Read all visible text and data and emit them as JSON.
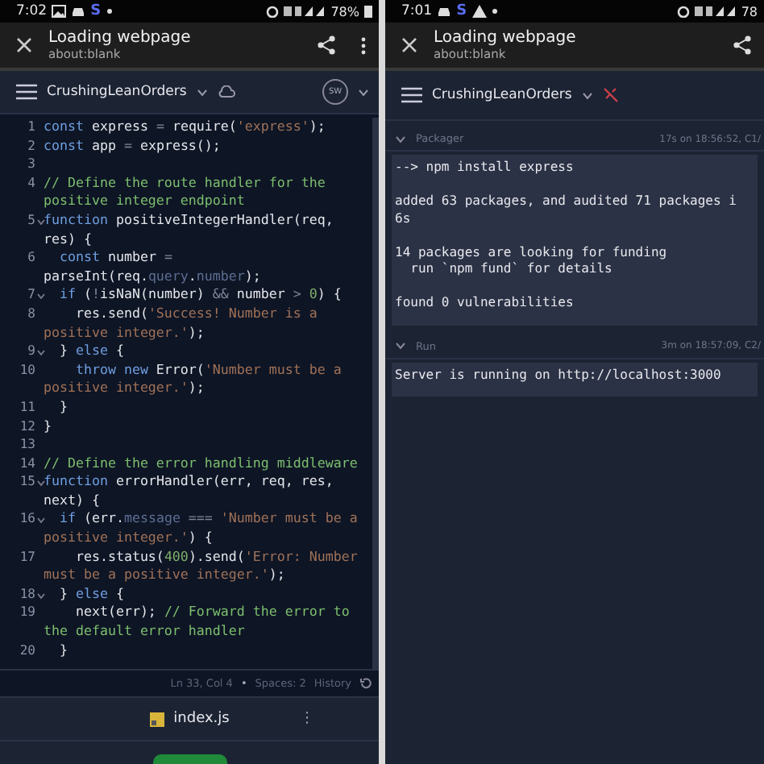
{
  "left": {
    "status_bar": {
      "time": "7:02",
      "app_letter": "S",
      "battery": "78%"
    },
    "header": {
      "title": "Loading webpage",
      "subtitle": "about:blank"
    },
    "toolbar": {
      "project": "CrushingLeanOrders",
      "avatar": "SW"
    },
    "code": [
      {
        "number": "1",
        "foldable": false,
        "rows": [
          {
            "tokens": [
              {
                "kind": "keyword",
                "text": "const"
              },
              {
                "kind": "plain",
                "text": " express "
              },
              {
                "kind": "operator",
                "text": "="
              },
              {
                "kind": "plain",
                "text": " require("
              },
              {
                "kind": "string",
                "text": "'express'"
              },
              {
                "kind": "plain",
                "text": ");"
              }
            ]
          }
        ]
      },
      {
        "number": "2",
        "foldable": false,
        "rows": [
          {
            "tokens": [
              {
                "kind": "keyword",
                "text": "const"
              },
              {
                "kind": "plain",
                "text": " app "
              },
              {
                "kind": "operator",
                "text": "="
              },
              {
                "kind": "plain",
                "text": " express();"
              }
            ]
          }
        ]
      },
      {
        "number": "3",
        "foldable": false
      },
      {
        "number": "4",
        "foldable": false,
        "rows": [
          {
            "tokens": [
              {
                "kind": "comment",
                "text": "// Define the route handler for the"
              }
            ]
          },
          {
            "tokens": [
              {
                "kind": "comment",
                "text": "positive integer endpoint"
              }
            ]
          }
        ]
      },
      {
        "number": "5",
        "foldable": true,
        "rows": [
          {
            "tokens": [
              {
                "kind": "keyword",
                "text": "function"
              },
              {
                "kind": "plain",
                "text": " positiveIntegerHandler(req,"
              }
            ]
          },
          {
            "tokens": [
              {
                "kind": "plain",
                "text": "res) {"
              }
            ]
          }
        ]
      },
      {
        "number": "6",
        "foldable": false,
        "rows": [
          {
            "tokens": [
              {
                "kind": "keyword",
                "text": "  const"
              },
              {
                "kind": "plain",
                "text": " number "
              },
              {
                "kind": "operator",
                "text": "="
              }
            ]
          },
          {
            "tokens": [
              {
                "kind": "plain",
                "text": "parseInt(req."
              },
              {
                "kind": "property",
                "text": "query"
              },
              {
                "kind": "plain",
                "text": "."
              },
              {
                "kind": "property",
                "text": "number"
              },
              {
                "kind": "plain",
                "text": ");"
              }
            ]
          }
        ]
      },
      {
        "number": "7",
        "foldable": true,
        "rows": [
          {
            "tokens": [
              {
                "kind": "keyword",
                "text": "  if"
              },
              {
                "kind": "plain",
                "text": " ("
              },
              {
                "kind": "operator",
                "text": "!"
              },
              {
                "kind": "plain",
                "text": "isNaN(number) "
              },
              {
                "kind": "operator",
                "text": "&&"
              },
              {
                "kind": "plain",
                "text": " number "
              },
              {
                "kind": "operator",
                "text": ">"
              },
              {
                "kind": "number",
                "text": " 0"
              },
              {
                "kind": "plain",
                "text": ") {"
              }
            ]
          }
        ]
      },
      {
        "number": "8",
        "foldable": false,
        "rows": [
          {
            "tokens": [
              {
                "kind": "plain",
                "text": "    res.send("
              },
              {
                "kind": "string",
                "text": "'Success! Number is a"
              }
            ]
          },
          {
            "tokens": [
              {
                "kind": "string",
                "text": "positive integer.'"
              },
              {
                "kind": "plain",
                "text": ");"
              }
            ]
          }
        ]
      },
      {
        "number": "9",
        "foldable": true,
        "rows": [
          {
            "tokens": [
              {
                "kind": "plain",
                "text": "  } "
              },
              {
                "kind": "keyword",
                "text": "else"
              },
              {
                "kind": "plain",
                "text": " {"
              }
            ]
          }
        ]
      },
      {
        "number": "10",
        "foldable": false,
        "rows": [
          {
            "tokens": [
              {
                "kind": "keyword",
                "text": "    throw new"
              },
              {
                "kind": "plain",
                "text": " Error("
              },
              {
                "kind": "string",
                "text": "'Number must be a"
              }
            ]
          },
          {
            "tokens": [
              {
                "kind": "string",
                "text": "positive integer.'"
              },
              {
                "kind": "plain",
                "text": ");"
              }
            ]
          }
        ]
      },
      {
        "number": "11",
        "foldable": false,
        "rows": [
          {
            "tokens": [
              {
                "kind": "plain",
                "text": "  }"
              }
            ]
          }
        ]
      },
      {
        "number": "12",
        "foldable": false,
        "rows": [
          {
            "tokens": [
              {
                "kind": "plain",
                "text": "}"
              }
            ]
          }
        ]
      },
      {
        "number": "13",
        "foldable": false
      },
      {
        "number": "14",
        "foldable": false,
        "rows": [
          {
            "tokens": [
              {
                "kind": "comment",
                "text": "// Define the error handling middleware"
              }
            ]
          }
        ]
      },
      {
        "number": "15",
        "foldable": true,
        "rows": [
          {
            "tokens": [
              {
                "kind": "keyword",
                "text": "function"
              },
              {
                "kind": "plain",
                "text": " errorHandler(err, req, res,"
              }
            ]
          },
          {
            "tokens": [
              {
                "kind": "plain",
                "text": "next) {"
              }
            ]
          }
        ]
      },
      {
        "number": "16",
        "foldable": true,
        "rows": [
          {
            "tokens": [
              {
                "kind": "keyword",
                "text": "  if"
              },
              {
                "kind": "plain",
                "text": " (err."
              },
              {
                "kind": "property",
                "text": "message"
              },
              {
                "kind": "operator",
                "text": " === "
              },
              {
                "kind": "string",
                "text": "'Number must be a"
              }
            ]
          },
          {
            "tokens": [
              {
                "kind": "string",
                "text": "positive integer.'"
              },
              {
                "kind": "plain",
                "text": ") {"
              }
            ]
          }
        ]
      },
      {
        "number": "17",
        "foldable": false,
        "rows": [
          {
            "tokens": [
              {
                "kind": "plain",
                "text": "    res.status("
              },
              {
                "kind": "number",
                "text": "400"
              },
              {
                "kind": "plain",
                "text": ").send("
              },
              {
                "kind": "string",
                "text": "'Error: Number"
              }
            ]
          },
          {
            "tokens": [
              {
                "kind": "string",
                "text": "must be a positive integer.'"
              },
              {
                "kind": "plain",
                "text": ");"
              }
            ]
          }
        ]
      },
      {
        "number": "18",
        "foldable": true,
        "rows": [
          {
            "tokens": [
              {
                "kind": "plain",
                "text": "  } "
              },
              {
                "kind": "keyword",
                "text": "else"
              },
              {
                "kind": "plain",
                "text": " {"
              }
            ]
          }
        ]
      },
      {
        "number": "19",
        "foldable": false,
        "rows": [
          {
            "tokens": [
              {
                "kind": "plain",
                "text": "    next(err); "
              },
              {
                "kind": "comment",
                "text": "// Forward the error to"
              }
            ]
          },
          {
            "tokens": [
              {
                "kind": "comment",
                "text": "the default error handler"
              }
            ]
          }
        ]
      },
      {
        "number": "20",
        "foldable": false,
        "rows": [
          {
            "tokens": [
              {
                "kind": "plain",
                "text": "  }"
              }
            ]
          }
        ]
      }
    ],
    "editor_status": {
      "position": "Ln 33, Col 4",
      "dot": "•",
      "spaces": "Spaces: 2",
      "history": "History"
    },
    "file_tab": {
      "name": "index.js",
      "menu": "⋮"
    }
  },
  "right": {
    "status_bar": {
      "time": "7:01",
      "app_letter": "S",
      "battery": "78"
    },
    "header": {
      "title": "Loading webpage",
      "subtitle": "about:blank"
    },
    "toolbar": {
      "project": "CrushingLeanOrders"
    },
    "sections": [
      {
        "title": "Packager",
        "meta": "17s on 18:56:52, C1/",
        "expanded": true,
        "blocks": [
          {
            "lines": [
              "--> npm install express"
            ]
          },
          {
            "lines": [
              "added 63 packages, and audited 71 packages i",
              "6s"
            ]
          },
          {
            "lines": [
              "14 packages are looking for funding",
              "  run `npm fund` for details"
            ]
          },
          {
            "lines": [
              "found 0 vulnerabilities"
            ]
          }
        ]
      },
      {
        "title": "Run",
        "meta": "3m on 18:57:09, C2/",
        "expanded": true,
        "blocks": [
          {
            "lines": [
              "Server is running on http://localhost:3000"
            ]
          }
        ]
      }
    ]
  }
}
